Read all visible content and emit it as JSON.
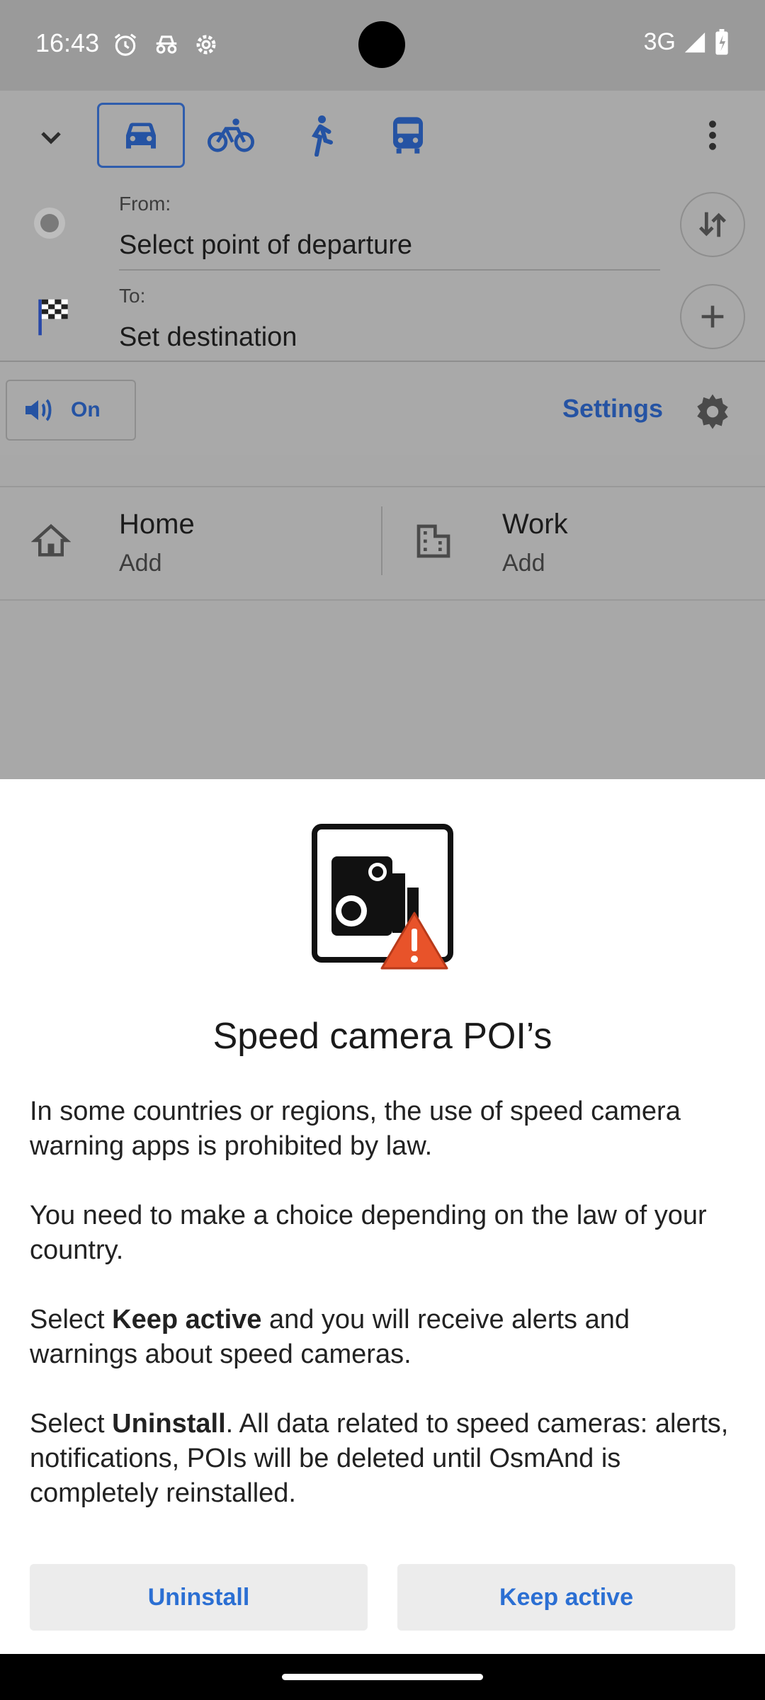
{
  "status_bar": {
    "time": "16:43",
    "network": "3G"
  },
  "route": {
    "modes": [
      {
        "name": "car",
        "icon": "car-icon",
        "active": true
      },
      {
        "name": "bicycle",
        "icon": "bicycle-icon"
      },
      {
        "name": "pedestrian",
        "icon": "walk-icon"
      },
      {
        "name": "public-transport",
        "icon": "bus-icon"
      }
    ],
    "from_label": "From:",
    "from_value": "Select point of departure",
    "to_label": "To:",
    "to_value": "Set destination",
    "sound_label": "On",
    "settings_label": "Settings"
  },
  "places": {
    "home_title": "Home",
    "home_sub": "Add",
    "work_title": "Work",
    "work_sub": "Add"
  },
  "dialog": {
    "title": "Speed camera POI’s",
    "p1": "In some countries or regions, the use of speed camera warning apps is prohibited by law.",
    "p2": "You need to make a choice depending on the law of your country.",
    "p3_pre": "Select ",
    "p3_bold": "Keep active",
    "p3_post": " and you will receive alerts and warnings about speed cameras.",
    "p4_pre": "Select ",
    "p4_bold": "Uninstall",
    "p4_post": ". All data related to speed cameras: alerts, notifications, POIs will be deleted until OsmAnd is completely reinstalled.",
    "uninstall_label": "Uninstall",
    "keep_label": "Keep active"
  },
  "colors": {
    "accent": "#2b6fd3",
    "warning": "#e8532a",
    "scrim": "#a8a8a8"
  }
}
